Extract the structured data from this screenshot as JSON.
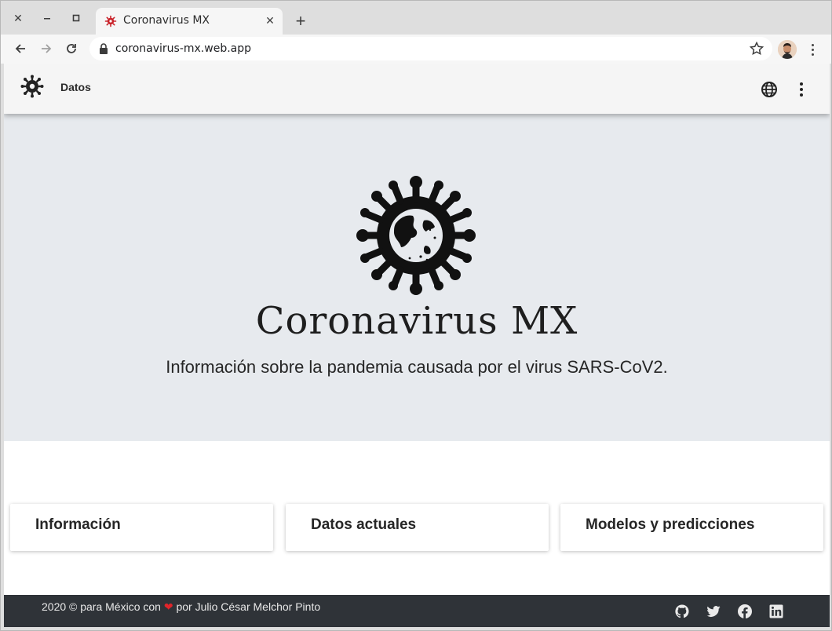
{
  "browser": {
    "tab_title": "Coronavirus MX",
    "url": "coronavirus-mx.web.app",
    "window_controls": {
      "close_icon": "close-icon",
      "minimize_icon": "minimize-icon",
      "maximize_icon": "maximize-icon"
    }
  },
  "appbar": {
    "nav_label": "Datos",
    "icons": [
      "virus-logo-icon",
      "globe-icon",
      "more-vert-icon"
    ]
  },
  "hero": {
    "title": "Coronavirus MX",
    "subtitle": "Información sobre la pandemia causada por el virus SARS-CoV2."
  },
  "cards": [
    {
      "title": "Información"
    },
    {
      "title": "Datos actuales"
    },
    {
      "title": "Modelos y predicciones"
    }
  ],
  "footer": {
    "text_before": "2020 © para México con ",
    "heart": "❤",
    "text_after": " por Julio César Melchor Pinto",
    "social": [
      "github-icon",
      "twitter-icon",
      "facebook-icon",
      "linkedin-icon"
    ]
  },
  "colors": {
    "hero_bg": "#e7eaee",
    "footer_bg": "#2f3338",
    "heart": "#e0242a"
  }
}
